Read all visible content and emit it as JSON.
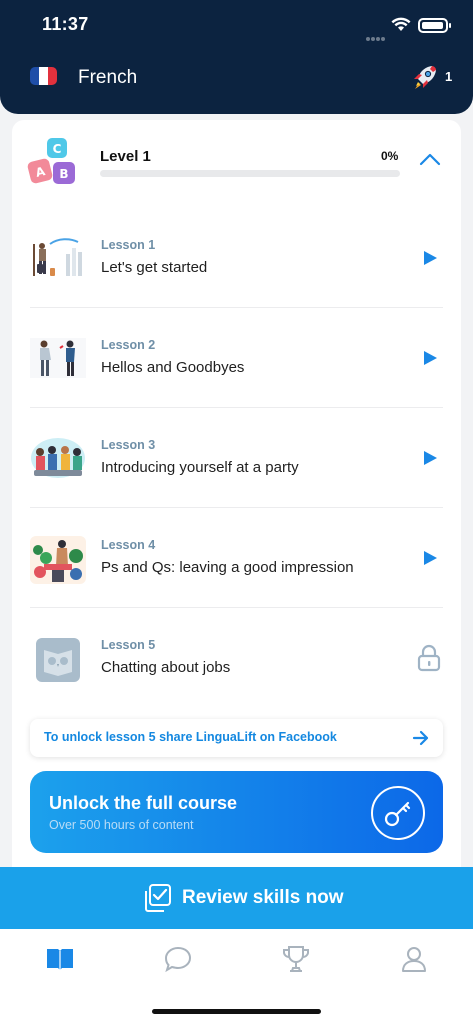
{
  "status_bar": {
    "time": "11:37"
  },
  "header": {
    "language": "French",
    "flag_colors": [
      "#1f4ea8",
      "#ffffff",
      "#e2313d"
    ],
    "rocket_count": "1"
  },
  "level": {
    "title": "Level 1",
    "percent_label": "0%",
    "progress": 0
  },
  "lessons": [
    {
      "number": "Lesson 1",
      "title": "Let's get started",
      "state": "play"
    },
    {
      "number": "Lesson 2",
      "title": "Hellos and Goodbyes",
      "state": "play"
    },
    {
      "number": "Lesson 3",
      "title": "Introducing yourself at a party",
      "state": "play"
    },
    {
      "number": "Lesson 4",
      "title": "Ps and Qs: leaving a good impression",
      "state": "play"
    },
    {
      "number": "Lesson 5",
      "title": "Chatting about jobs",
      "state": "locked"
    }
  ],
  "unlock_banner": {
    "text": "To unlock lesson 5 share LinguaLift on Facebook"
  },
  "full_course": {
    "title": "Unlock the full course",
    "subtitle": "Over 500 hours of content"
  },
  "review_button": {
    "label": "Review skills now"
  },
  "tabs": [
    "lessons",
    "chat",
    "trophies",
    "profile"
  ],
  "colors": {
    "header_bg": "#0c2340",
    "accent": "#1a88e6",
    "review_bg": "#1aa1ea",
    "lesson_number": "#6f8fa7"
  }
}
